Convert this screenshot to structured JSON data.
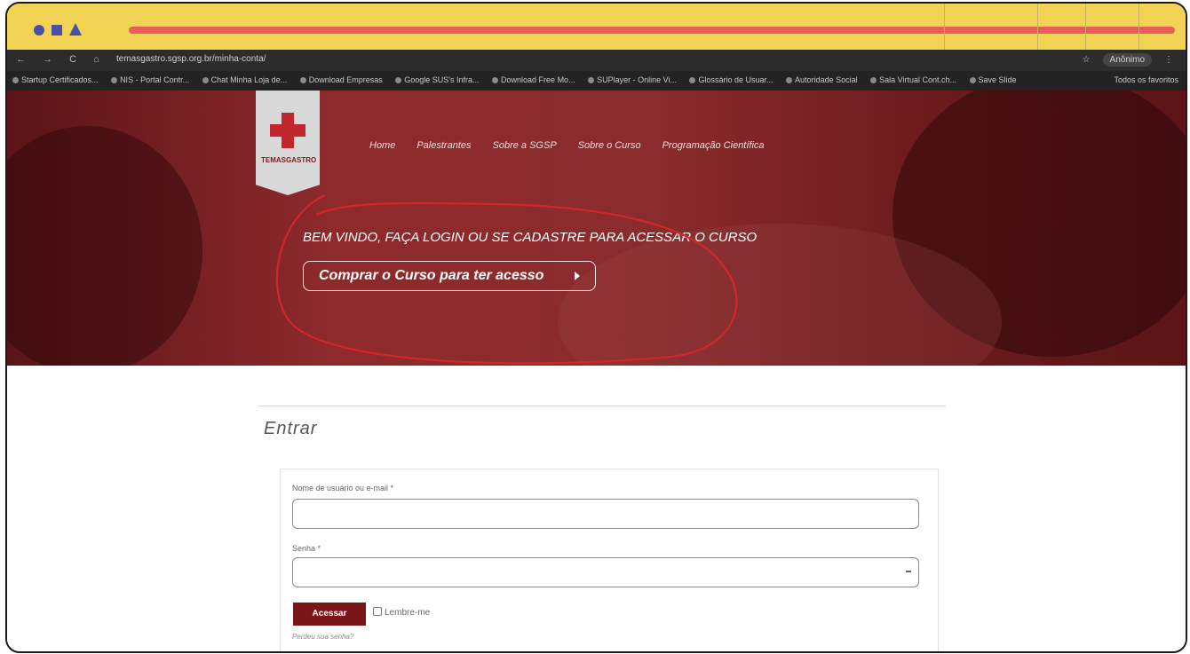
{
  "browser": {
    "url": "temasgastro.sgsp.org.br/minha-conta/",
    "profile_label": "Anônimo",
    "bookmarks": [
      "Startup Certificados...",
      "NIS - Portal Contr...",
      "Chat Minha Loja de...",
      "Download Empresas",
      "Google SUS's Infra...",
      "Download Free Mo...",
      "SUPlayer - Online Vi...",
      "Glossário de Usuar...",
      "Autoridade Social",
      "Sala Virtual Cont.ch...",
      "Save Slide"
    ],
    "all_bookmarks_label": "Todos os favoritos"
  },
  "site": {
    "logo_text": "TEMASGASTRO",
    "nav": [
      "Home",
      "Palestrantes",
      "Sobre a SGSP",
      "Sobre o Curso",
      "Programação Científica"
    ],
    "welcome": "BEM VINDO, FAÇA LOGIN OU SE CADASTRE PARA ACESSAR O CURSO",
    "cta_label": "Comprar o Curso para ter acesso"
  },
  "login": {
    "title": "Entrar",
    "username_label": "Nome de usuário ou e-mail *",
    "password_label": "Senha *",
    "submit_label": "Acessar",
    "remember_label": "Lembre-me",
    "lost_password": "Perdeu sua senha?"
  },
  "colors": {
    "frame": "#f3d354",
    "accent_line": "#ea5e5a",
    "brand_red": "#7a1518"
  }
}
